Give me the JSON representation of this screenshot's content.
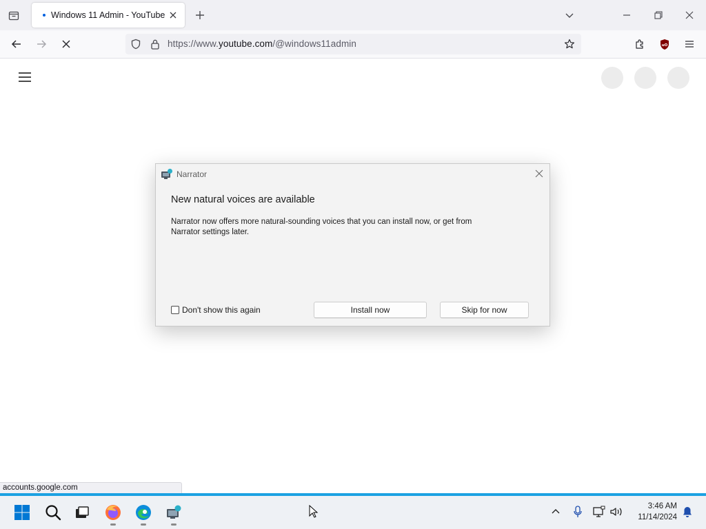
{
  "browser": {
    "tab": {
      "title": "Windows 11 Admin - YouTube"
    },
    "url": {
      "prefix": "https://www.",
      "host": "youtube.com",
      "path": "/@windows11admin"
    },
    "status_url": "accounts.google.com"
  },
  "dialog": {
    "app_name": "Narrator",
    "heading": "New natural voices are available",
    "body": "Narrator now offers more natural-sounding voices that you can install now, or get from Narrator settings later.",
    "checkbox_label": "Don't show this again",
    "checkbox_checked": false,
    "install_label": "Install now",
    "skip_label": "Skip for now"
  },
  "taskbar": {
    "time": "3:46 AM",
    "date": "11/14/2024",
    "pinned": [
      "windows-start",
      "search",
      "task-view",
      "firefox",
      "edge",
      "narrator"
    ]
  },
  "colors": {
    "accent": "#1ba1e2",
    "windows_blue": "#0078d4",
    "ublock_red": "#800000"
  }
}
